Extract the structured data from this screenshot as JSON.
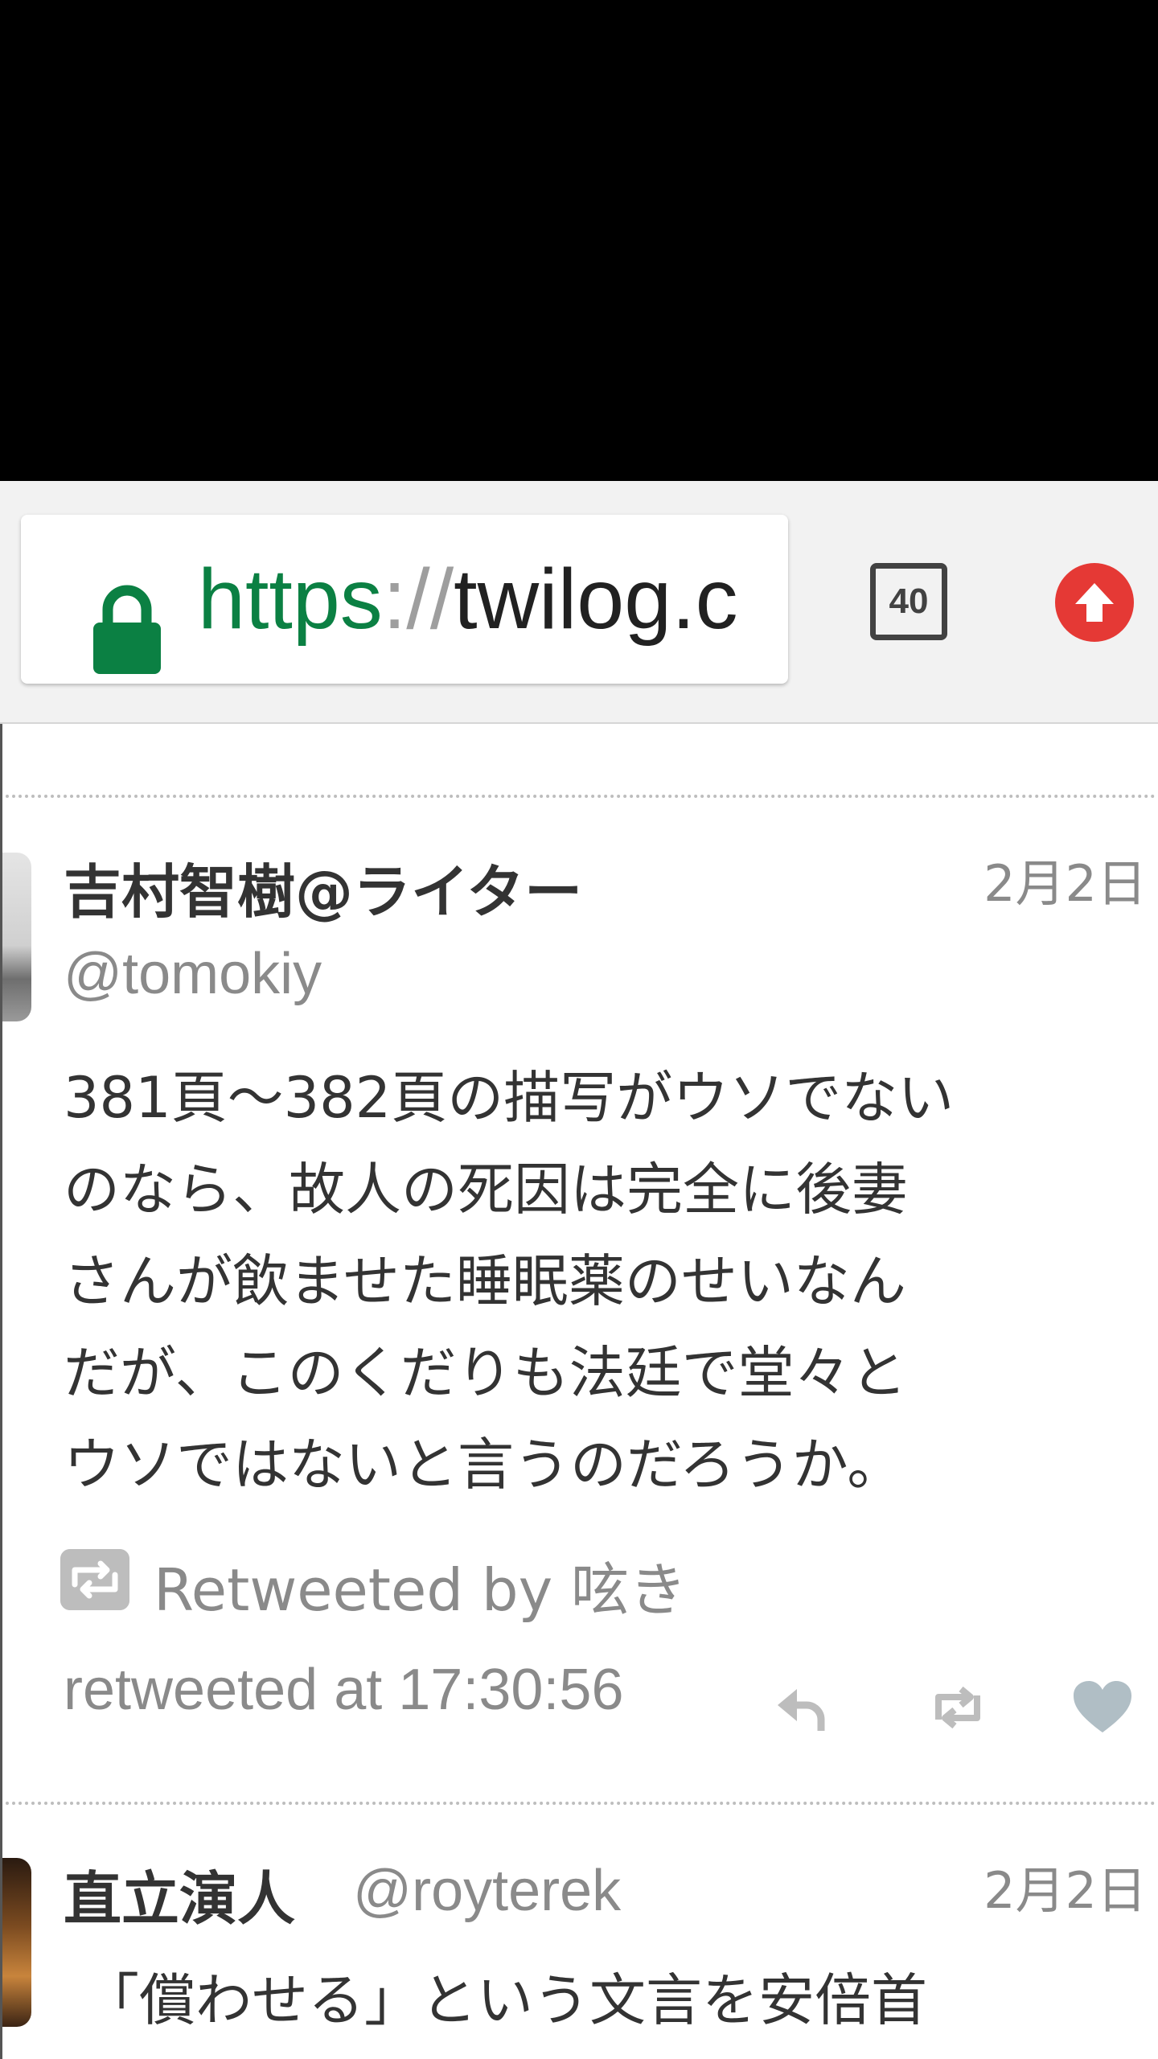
{
  "browser": {
    "url_scheme": "https",
    "url_separator": "://",
    "url_host_visible": "twilog.c",
    "tab_count": "40"
  },
  "tweets": [
    {
      "name": "吉村智樹@ライター",
      "handle": "@tomokiy",
      "date": "2月2日",
      "text_lines": [
        "381頁〜382頁の描写がウソでない",
        "のなら、故人の死因は完全に後妻",
        "さんが飲ませた睡眠薬のせいなん",
        "だが、このくだりも法廷で堂々と",
        "ウソではないと言うのだろうか。"
      ],
      "retweeted_by": "Retweeted by 呟き",
      "retweeted_at": "retweeted at 17:30:56"
    },
    {
      "name": "直立演人",
      "handle": "@royterek",
      "date": "2月2日",
      "text_lines": [
        "「償わせる」という文言を安倍首"
      ]
    }
  ],
  "colors": {
    "secure_green": "#0b8043",
    "update_red": "#e53935",
    "icon_gray": "#bdbdbd",
    "text_dark": "#333333",
    "text_muted": "#8a8a8a"
  },
  "icons": [
    "lock-icon",
    "tab-switcher-icon",
    "update-arrow-icon",
    "retweet-badge-icon",
    "reply-icon",
    "retweet-icon",
    "like-icon"
  ]
}
